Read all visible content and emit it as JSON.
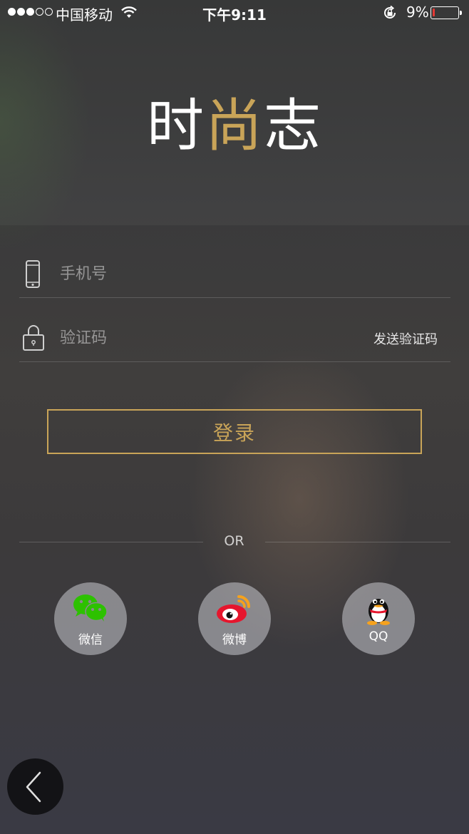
{
  "status_bar": {
    "carrier": "中国移动",
    "time": "下午9:11",
    "battery_percent": "9%",
    "battery_level": 0.09,
    "signal_bars": 3,
    "signal_total": 5,
    "icons": [
      "signal-dots-icon",
      "wifi-icon",
      "rotation-lock-icon",
      "battery-icon"
    ]
  },
  "logo": {
    "text_part1": "时",
    "text_accent": "尚",
    "text_part2": "志",
    "accent_color": "#c9a458"
  },
  "form": {
    "phone": {
      "placeholder": "手机号",
      "value": "",
      "icon": "phone-icon"
    },
    "code": {
      "placeholder": "验证码",
      "value": "",
      "icon": "lock-icon"
    },
    "send_code_label": "发送验证码"
  },
  "login": {
    "label": "登录",
    "border_color": "#c9a458"
  },
  "divider": {
    "text": "OR"
  },
  "social": {
    "wechat": {
      "label": "微信",
      "icon": "wechat-icon"
    },
    "weibo": {
      "label": "微博",
      "icon": "weibo-icon"
    },
    "qq": {
      "label": "QQ",
      "icon": "qq-icon"
    }
  },
  "back": {
    "icon": "chevron-left-icon"
  }
}
